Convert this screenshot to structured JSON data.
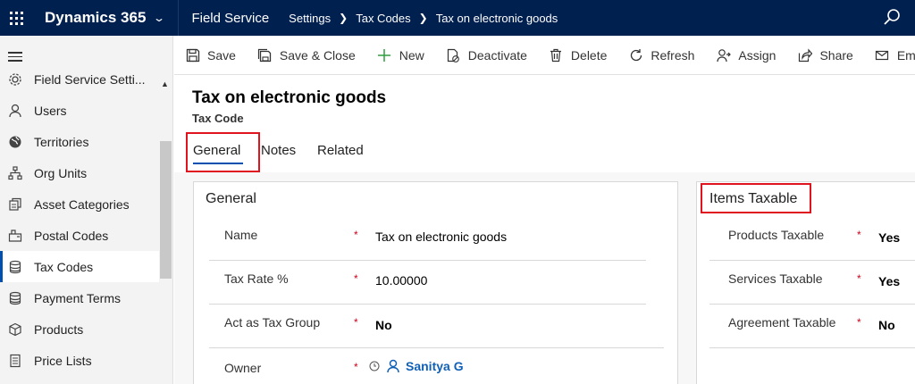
{
  "topbar": {
    "app_name": "Dynamics 365",
    "module": "Field Service",
    "breadcrumbs": [
      "Settings",
      "Tax Codes",
      "Tax on electronic goods"
    ],
    "colors": {
      "background": "#002050",
      "text": "#ffffff"
    }
  },
  "sidebar": {
    "items": [
      {
        "label": "Field Service Setti...",
        "icon": "gear-icon"
      },
      {
        "label": "Users",
        "icon": "person-icon"
      },
      {
        "label": "Territories",
        "icon": "globe-icon"
      },
      {
        "label": "Org Units",
        "icon": "org-chart-icon"
      },
      {
        "label": "Asset Categories",
        "icon": "asset-icon"
      },
      {
        "label": "Postal Codes",
        "icon": "postal-icon"
      },
      {
        "label": "Tax Codes",
        "icon": "database-icon",
        "selected": true
      },
      {
        "label": "Payment Terms",
        "icon": "database-icon"
      },
      {
        "label": "Products",
        "icon": "box-icon"
      },
      {
        "label": "Price Lists",
        "icon": "document-icon"
      }
    ]
  },
  "commands": [
    {
      "label": "Save",
      "icon": "save-icon"
    },
    {
      "label": "Save & Close",
      "icon": "save-close-icon"
    },
    {
      "label": "New",
      "icon": "plus-icon"
    },
    {
      "label": "Deactivate",
      "icon": "deactivate-icon"
    },
    {
      "label": "Delete",
      "icon": "trash-icon"
    },
    {
      "label": "Refresh",
      "icon": "refresh-icon"
    },
    {
      "label": "Assign",
      "icon": "assign-icon"
    },
    {
      "label": "Share",
      "icon": "share-icon"
    },
    {
      "label": "Email a L",
      "icon": "email-icon"
    }
  ],
  "record": {
    "title": "Tax on electronic goods",
    "entity": "Tax Code"
  },
  "tabs": [
    "General",
    "Notes",
    "Related"
  ],
  "general_section": {
    "title": "General",
    "fields": [
      {
        "label": "Name",
        "required": "*",
        "value": "Tax on electronic goods"
      },
      {
        "label": "Tax Rate %",
        "required": "*",
        "value": "10.00000"
      },
      {
        "label": "Act as Tax Group",
        "required": "*",
        "value": "No"
      },
      {
        "label": "Owner",
        "required": "*",
        "value": "Sanitya G"
      }
    ]
  },
  "items_taxable_section": {
    "title": "Items Taxable",
    "fields": [
      {
        "label": "Products Taxable",
        "required": "*",
        "value": "Yes"
      },
      {
        "label": "Services Taxable",
        "required": "*",
        "value": "Yes"
      },
      {
        "label": "Agreement Taxable",
        "required": "*",
        "value": "No"
      }
    ]
  },
  "highlight_color": "#e0141e",
  "accent_color": "#0050b0"
}
